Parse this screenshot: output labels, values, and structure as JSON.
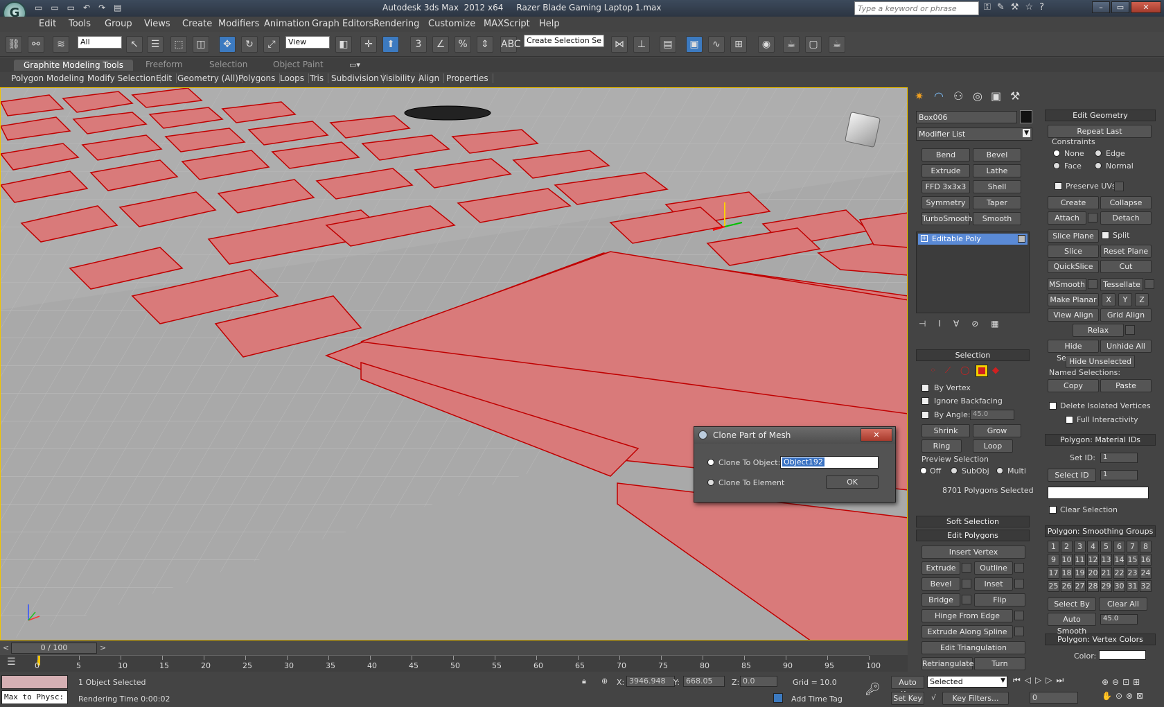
{
  "app": {
    "title": "Autodesk 3ds Max  2012 x64     Razer Blade Gaming Laptop 1.max",
    "search_placeholder": "Type a keyword or phrase"
  },
  "menu": [
    "Edit",
    "Tools",
    "Group",
    "Views",
    "Create",
    "Modifiers",
    "Animation",
    "Graph Editors",
    "Rendering",
    "Customize",
    "MAXScript",
    "Help"
  ],
  "toolbar": {
    "filter_select": "All",
    "ref_coord_select": "View",
    "named_selection": "Create Selection Se"
  },
  "ribbon": {
    "tabs": [
      "Graphite Modeling Tools",
      "Freeform",
      "Selection",
      "Object Paint"
    ],
    "items": [
      "Polygon Modeling",
      "Modify Selection",
      "Edit",
      "Geometry (All)",
      "Polygons",
      "Loops",
      "Tris",
      "Subdivision",
      "Visibility",
      "Align",
      "Properties"
    ]
  },
  "command_panel": {
    "object_name": "Box006",
    "modifier_list": "Modifier List",
    "modifier_buttons": [
      [
        "Bend",
        "Bevel"
      ],
      [
        "Extrude",
        "Lathe"
      ],
      [
        "FFD 3x3x3",
        "Shell"
      ],
      [
        "Symmetry",
        "Taper"
      ],
      [
        "TurboSmooth",
        "Smooth"
      ]
    ],
    "stack_item": "Editable Poly",
    "selection": {
      "header": "Selection",
      "by_vertex": "By Vertex",
      "ignore_backfacing": "Ignore Backfacing",
      "by_angle": "By Angle:",
      "angle_value": "45.0",
      "shrink": "Shrink",
      "grow": "Grow",
      "ring": "Ring",
      "loop": "Loop",
      "preview_selection": "Preview Selection",
      "off": "Off",
      "subobj": "SubObj",
      "multi": "Multi",
      "count": "8701 Polygons Selected"
    },
    "soft_selection": "Soft Selection",
    "edit_polygons": {
      "header": "Edit Polygons",
      "insert_vertex": "Insert Vertex",
      "extrude": "Extrude",
      "outline": "Outline",
      "bevel": "Bevel",
      "inset": "Inset",
      "bridge": "Bridge",
      "flip": "Flip",
      "hinge": "Hinge From Edge",
      "extrude_spline": "Extrude Along Spline",
      "edit_tri": "Edit Triangulation",
      "retriangulate": "Retriangulate",
      "turn": "Turn"
    },
    "edit_geometry": {
      "header": "Edit Geometry",
      "repeat_last": "Repeat Last",
      "constraints": "Constraints",
      "none": "None",
      "edge": "Edge",
      "face": "Face",
      "normal": "Normal",
      "preserve_uvs": "Preserve UVs",
      "create": "Create",
      "collapse": "Collapse",
      "attach": "Attach",
      "detach": "Detach",
      "slice_plane": "Slice Plane",
      "split": "Split",
      "slice": "Slice",
      "reset_plane": "Reset Plane",
      "quickslice": "QuickSlice",
      "cut": "Cut",
      "msmooth": "MSmooth",
      "tessellate": "Tessellate",
      "make_planar": "Make Planar",
      "x": "X",
      "y": "Y",
      "z": "Z",
      "view_align": "View Align",
      "grid_align": "Grid Align",
      "relax": "Relax",
      "hide_selected": "Hide Selected",
      "unhide_all": "Unhide All",
      "hide_unselected": "Hide Unselected",
      "named_selections": "Named Selections:",
      "copy": "Copy",
      "paste": "Paste",
      "delete_isolated": "Delete Isolated Vertices",
      "full_interactivity": "Full Interactivity"
    },
    "material_ids": {
      "header": "Polygon: Material IDs",
      "set_id": "Set ID:",
      "set_id_value": "1",
      "select_id": "Select ID",
      "select_id_value": "1",
      "clear_selection": "Clear Selection"
    },
    "smoothing": {
      "header": "Polygon: Smoothing Groups",
      "groups": [
        "1",
        "2",
        "3",
        "4",
        "5",
        "6",
        "7",
        "8",
        "9",
        "10",
        "11",
        "12",
        "13",
        "14",
        "15",
        "16",
        "17",
        "18",
        "19",
        "20",
        "21",
        "22",
        "23",
        "24",
        "25",
        "26",
        "27",
        "28",
        "29",
        "30",
        "31",
        "32"
      ],
      "select_by_sg": "Select By SG",
      "clear_all": "Clear All",
      "auto_smooth": "Auto Smooth",
      "auto_smooth_value": "45.0"
    },
    "vertex_colors": {
      "header": "Polygon: Vertex Colors",
      "color": "Color:"
    }
  },
  "dialog": {
    "title": "Clone Part of Mesh",
    "clone_to_object": "Clone To Object:",
    "object_value": "Object192",
    "clone_to_element": "Clone To Element",
    "ok": "OK"
  },
  "timeline": {
    "frame": "0 / 100",
    "ticks": [
      "0",
      "5",
      "10",
      "15",
      "20",
      "25",
      "30",
      "35",
      "40",
      "45",
      "50",
      "55",
      "60",
      "65",
      "70",
      "75",
      "80",
      "85",
      "90",
      "95",
      "100"
    ]
  },
  "status": {
    "selected": "1 Object Selected",
    "render_time": "Rendering Time  0:00:02",
    "maxscript": "Max to Physc:",
    "x_label": "X:",
    "x_value": "3946.948",
    "y_label": "Y:",
    "y_value": "668.05",
    "z_label": "Z:",
    "z_value": "0.0",
    "grid": "Grid = 10.0",
    "add_time_tag": "Add Time Tag",
    "auto_key": "Auto Key",
    "set_key": "Set Key",
    "key_mode": "Selected",
    "key_filters": "Key Filters...",
    "frame_value": "0"
  },
  "colors": {
    "selection_red": "#e05050",
    "viewport_gray": "#a9a9a9",
    "accent_yellow": "#f2c400"
  }
}
